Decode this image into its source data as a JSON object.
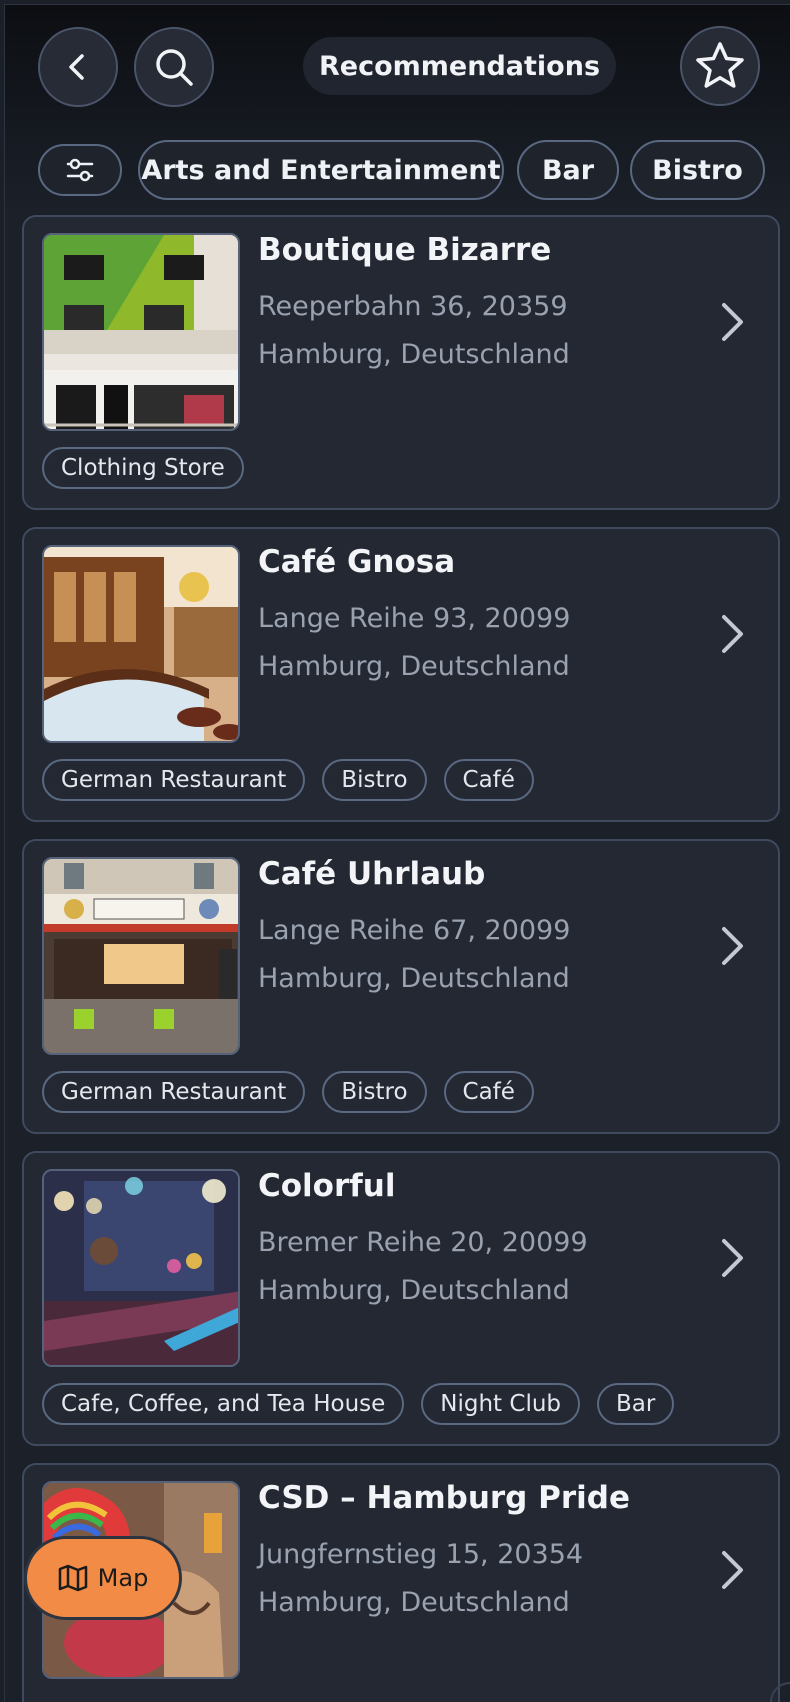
{
  "header": {
    "title": "Recommendations",
    "back_icon": "chevron-left-icon",
    "search_icon": "search-icon",
    "favorite_icon": "star-icon"
  },
  "filters": {
    "filter_icon": "sliders-icon",
    "chips": [
      "Arts and Entertainment",
      "Bar",
      "Bistro"
    ]
  },
  "places": [
    {
      "name": "Boutique Bizarre",
      "address_line1": "Reeperbahn 36, 20359",
      "address_line2": "Hamburg, Deutschland",
      "tags": [
        "Clothing Store"
      ]
    },
    {
      "name": "Café Gnosa",
      "address_line1": "Lange Reihe 93, 20099",
      "address_line2": "Hamburg, Deutschland",
      "tags": [
        "German Restaurant",
        "Bistro",
        "Café"
      ]
    },
    {
      "name": "Café Uhrlaub",
      "address_line1": "Lange Reihe 67, 20099",
      "address_line2": "Hamburg, Deutschland",
      "tags": [
        "German Restaurant",
        "Bistro",
        "Café"
      ]
    },
    {
      "name": "Colorful",
      "address_line1": "Bremer Reihe 20, 20099",
      "address_line2": "Hamburg, Deutschland",
      "tags": [
        "Cafe, Coffee, and Tea House",
        "Night Club",
        "Bar"
      ]
    },
    {
      "name": "CSD – Hamburg Pride",
      "address_line1": "Jungfernstieg 15, 20354",
      "address_line2": "Hamburg, Deutschland",
      "tags": []
    }
  ],
  "map_button": {
    "label": "Map",
    "icon": "map-icon"
  },
  "colors": {
    "background": "#1c2029",
    "card": "#232833",
    "border": "#3f4a5e",
    "accent_orange": "#f28b45"
  }
}
